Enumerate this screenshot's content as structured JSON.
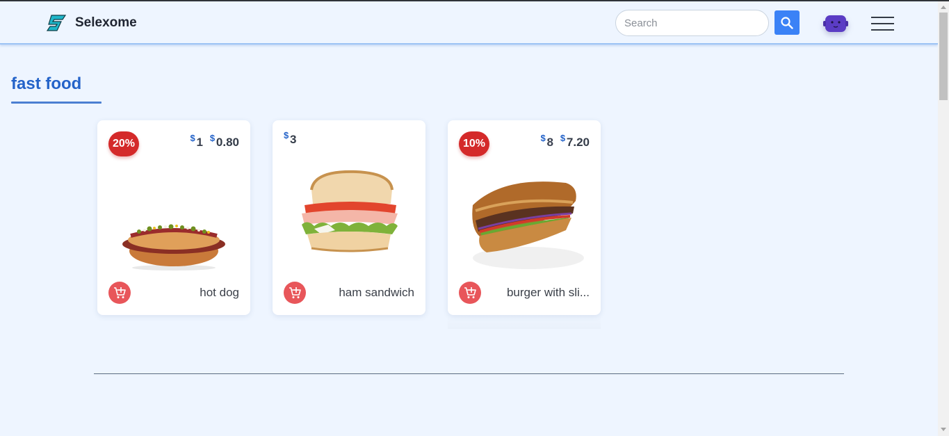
{
  "header": {
    "brand": "Selexome",
    "search_placeholder": "Search"
  },
  "category": {
    "title": "fast food"
  },
  "products": [
    {
      "name": "hot dog",
      "discount": "20%",
      "old_price": "1",
      "price": "0.80",
      "currency": "$"
    },
    {
      "name": "ham sandwich",
      "price": "3",
      "currency": "$"
    },
    {
      "name": "burger with sli...",
      "discount": "10%",
      "old_price": "8",
      "price": "7.20",
      "currency": "$"
    }
  ],
  "colors": {
    "accent": "#3b82f6",
    "badge": "#d42a2a",
    "cart": "#e8565a",
    "title": "#2463c9"
  }
}
